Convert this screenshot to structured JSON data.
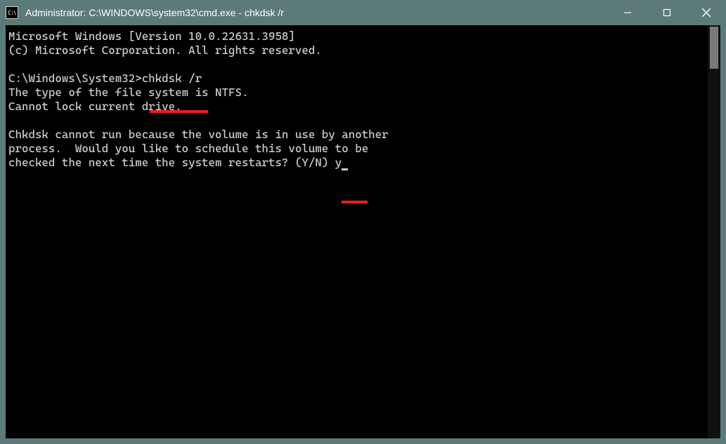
{
  "titlebar": {
    "icon_label": "C:\\",
    "title": "Administrator: C:\\WINDOWS\\system32\\cmd.exe - chkdsk  /r"
  },
  "console": {
    "line1": "Microsoft Windows [Version 10.0.22631.3958]",
    "line2": "(c) Microsoft Corporation. All rights reserved.",
    "blank1": "",
    "prompt_line": "C:\\Windows\\System32>chkdsk /r",
    "line4": "The type of the file system is NTFS.",
    "line5": "Cannot lock current drive.",
    "blank2": "",
    "line6": "Chkdsk cannot run because the volume is in use by another",
    "line7": "process.  Would you like to schedule this volume to be",
    "line8_prefix": "checked the next time the system restarts? (Y/N) ",
    "user_input": "y"
  }
}
